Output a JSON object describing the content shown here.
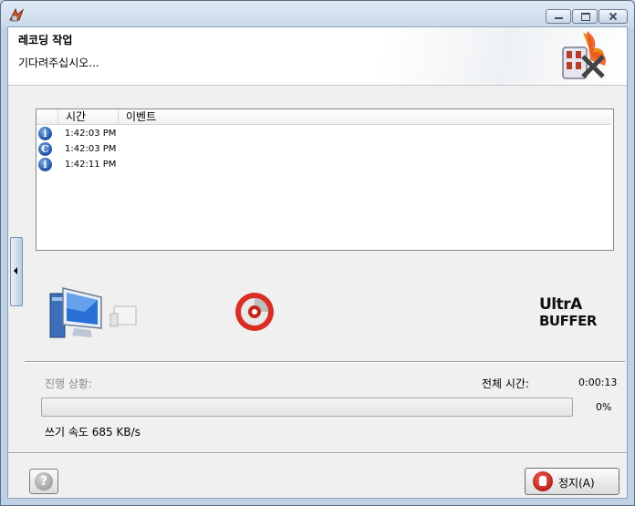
{
  "window": {
    "title": ""
  },
  "header": {
    "title": "레코딩 작업",
    "subtitle": "기다려주십시오..."
  },
  "log": {
    "columns": [
      "",
      "시간",
      "이벤트"
    ],
    "rows": [
      {
        "icon": "info-icon",
        "glyph": "i",
        "time": "1:42:03 PM",
        "event": ""
      },
      {
        "icon": "disc-event-icon",
        "glyph": "C",
        "time": "1:42:03 PM",
        "event": ""
      },
      {
        "icon": "info-icon",
        "glyph": "i",
        "time": "1:42:11 PM",
        "event": ""
      }
    ]
  },
  "status": {
    "progress_label": "진행 상황:",
    "total_time_label": "전체 시간:",
    "total_time_value": "0:00:13",
    "progress_percent": "0%",
    "progress_fraction": 0,
    "write_speed": "쓰기 속도 685 KB/s"
  },
  "buttons": {
    "stop_label": "정지(A)",
    "help_glyph": "?"
  },
  "colors": {
    "progress": "#37b73a",
    "accent": "#1b4d9e",
    "stop": "#b21a10"
  }
}
